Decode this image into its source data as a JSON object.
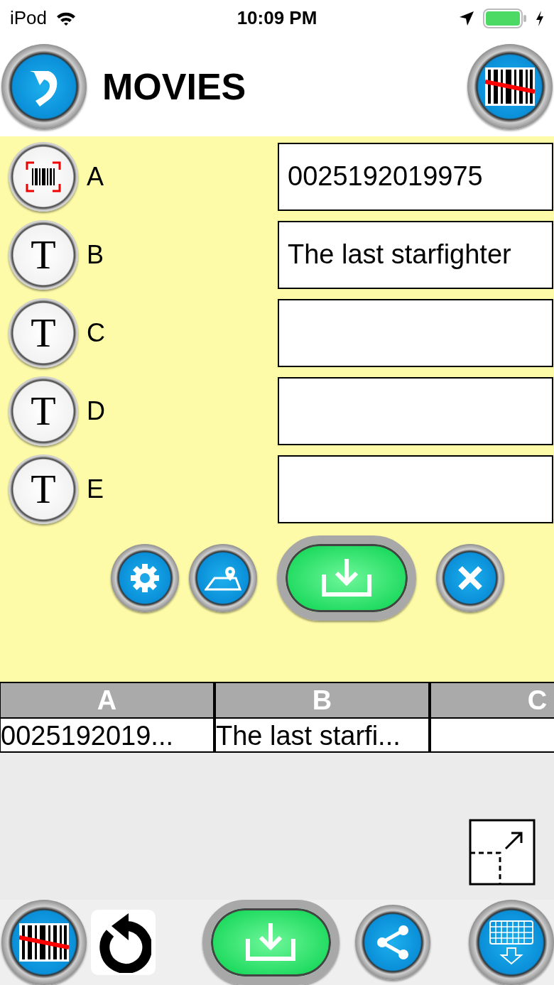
{
  "status_bar": {
    "carrier": "iPod",
    "time": "10:09 PM"
  },
  "header": {
    "title": "MOVIES"
  },
  "fields": [
    {
      "kind": "barcode",
      "label": "A",
      "value": "0025192019975"
    },
    {
      "kind": "text",
      "icon_glyph": "T",
      "label": "B",
      "value": "The last starfighter"
    },
    {
      "kind": "text",
      "icon_glyph": "T",
      "label": "C"
    },
    {
      "kind": "text",
      "icon_glyph": "T",
      "label": "D"
    },
    {
      "kind": "text",
      "icon_glyph": "T",
      "label": "E"
    }
  ],
  "table": {
    "columns": [
      "A",
      "B",
      "C"
    ],
    "rows": [
      {
        "cells": [
          "0025192019...",
          "The last starfi..."
        ]
      }
    ]
  }
}
